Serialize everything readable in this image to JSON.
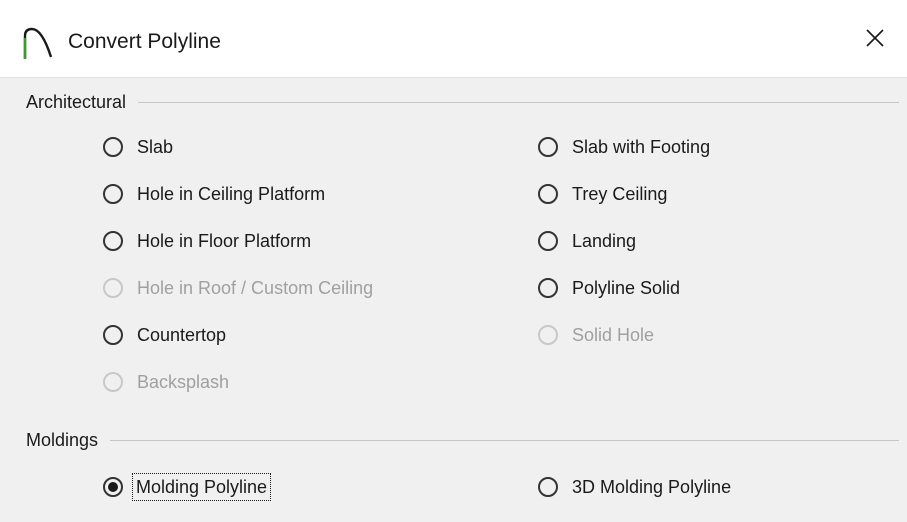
{
  "dialog": {
    "title": "Convert Polyline",
    "close_symbol": "✕"
  },
  "architectural": {
    "label": "Architectural",
    "options": [
      {
        "label": "Slab",
        "enabled": true,
        "checked": false
      },
      {
        "label": "Slab with Footing",
        "enabled": true,
        "checked": false
      },
      {
        "label": "Hole in Ceiling Platform",
        "enabled": true,
        "checked": false
      },
      {
        "label": "Trey Ceiling",
        "enabled": true,
        "checked": false
      },
      {
        "label": "Hole in Floor Platform",
        "enabled": true,
        "checked": false
      },
      {
        "label": "Landing",
        "enabled": true,
        "checked": false
      },
      {
        "label": "Hole in Roof / Custom Ceiling",
        "enabled": false,
        "checked": false
      },
      {
        "label": "Polyline Solid",
        "enabled": true,
        "checked": false
      },
      {
        "label": "Countertop",
        "enabled": true,
        "checked": false
      },
      {
        "label": "Solid Hole",
        "enabled": false,
        "checked": false
      },
      {
        "label": "Backsplash",
        "enabled": false,
        "checked": false
      }
    ]
  },
  "moldings": {
    "label": "Moldings",
    "options": [
      {
        "label": "Molding Polyline",
        "enabled": true,
        "checked": true
      },
      {
        "label": "3D Molding Polyline",
        "enabled": true,
        "checked": false
      }
    ]
  },
  "colors": {
    "text": "#1a1a1a",
    "disabled_text": "#a0a0a0",
    "background": "#f0f0f0",
    "titlebar": "#ffffff"
  }
}
